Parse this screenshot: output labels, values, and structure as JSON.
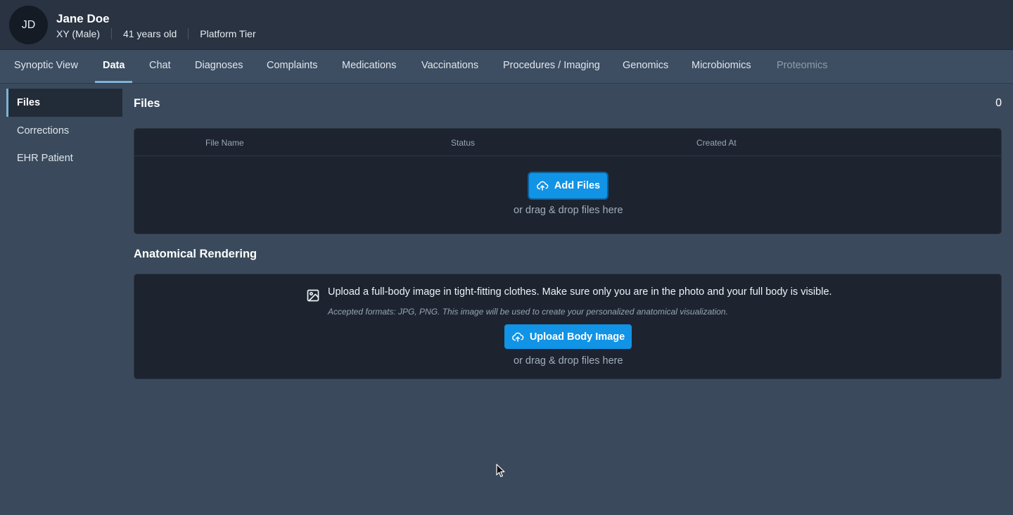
{
  "patient": {
    "initials": "JD",
    "name": "Jane Doe",
    "sex": "XY (Male)",
    "age": "41 years old",
    "tier": "Platform Tier"
  },
  "tabs": [
    {
      "label": "Synoptic View"
    },
    {
      "label": "Data",
      "active": true
    },
    {
      "label": "Chat"
    },
    {
      "label": "Diagnoses"
    },
    {
      "label": "Complaints"
    },
    {
      "label": "Medications"
    },
    {
      "label": "Vaccinations"
    },
    {
      "label": "Procedures / Imaging"
    },
    {
      "label": "Genomics"
    },
    {
      "label": "Microbiomics"
    },
    {
      "label": "Proteomics",
      "disabled": true
    }
  ],
  "sidebar": {
    "items": [
      {
        "label": "Files",
        "active": true
      },
      {
        "label": "Corrections"
      },
      {
        "label": "EHR Patient"
      }
    ]
  },
  "files": {
    "title": "Files",
    "count": "0",
    "columns": [
      "File Name",
      "Status",
      "Created At"
    ],
    "add_button": "Add Files",
    "drop_hint": "or drag & drop files here"
  },
  "anatomical": {
    "title": "Anatomical Rendering",
    "instructions": "Upload a full-body image in tight-fitting clothes. Make sure only you are in the photo and your full body is visible.",
    "formats_note": "Accepted formats: JPG, PNG. This image will be used to create your personalized anatomical visualization.",
    "upload_button": "Upload Body Image",
    "drop_hint": "or drag & drop files here"
  },
  "icons": {
    "upload": "cloud-upload-icon",
    "image": "image-icon",
    "cursor": "mouse-pointer-icon"
  },
  "colors": {
    "accent": "#1193e6",
    "active_tab_underline": "#7fb2d6",
    "background": "#3a4a5c"
  }
}
